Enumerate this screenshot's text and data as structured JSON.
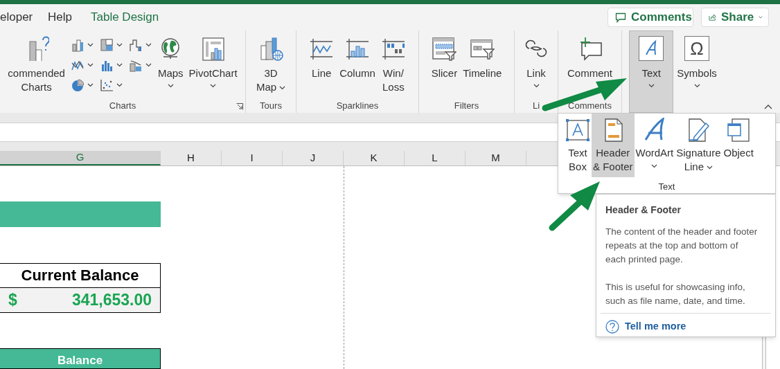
{
  "tabs": [
    {
      "label": "eloper",
      "contextual": false
    },
    {
      "label": "Help",
      "contextual": false
    },
    {
      "label": "Table Design",
      "contextual": true
    }
  ],
  "top_buttons": [
    {
      "kind": "comments",
      "label": "Comments",
      "has_menu": false
    },
    {
      "kind": "share",
      "label": "Share",
      "has_menu": true
    }
  ],
  "ribbon": {
    "groups": [
      {
        "label": "Charts",
        "launcher": true,
        "items": [
          {
            "kind": "large",
            "label": "commended\nCharts",
            "has_menu": false,
            "expanded": false
          },
          {
            "kind": "gallery"
          },
          {
            "kind": "large",
            "label": "Maps",
            "has_menu": true,
            "expanded": false
          },
          {
            "kind": "large",
            "label": "PivotChart",
            "has_menu": true,
            "expanded": false
          }
        ]
      },
      {
        "label": "Tours",
        "launcher": false,
        "items": [
          {
            "kind": "large",
            "label": "3D\nMap",
            "has_menu": true,
            "expanded": false
          }
        ]
      },
      {
        "label": "Sparklines",
        "launcher": false,
        "items": [
          {
            "kind": "large",
            "label": "Line",
            "has_menu": false,
            "expanded": false
          },
          {
            "kind": "large",
            "label": "Column",
            "has_menu": false,
            "expanded": false
          },
          {
            "kind": "large",
            "label": "Win/\nLoss",
            "has_menu": false,
            "expanded": false
          }
        ]
      },
      {
        "label": "Filters",
        "launcher": false,
        "items": [
          {
            "kind": "large",
            "label": "Slicer",
            "has_menu": false,
            "expanded": false
          },
          {
            "kind": "large",
            "label": "Timeline",
            "has_menu": false,
            "expanded": false
          }
        ]
      },
      {
        "label": "Li",
        "launcher": false,
        "items": [
          {
            "kind": "large",
            "label": "Link",
            "has_menu": true,
            "expanded": false
          }
        ]
      },
      {
        "label": "Comments",
        "launcher": false,
        "items": [
          {
            "kind": "large",
            "label": "Comment",
            "has_menu": false,
            "expanded": false
          }
        ]
      },
      {
        "launcher": false,
        "items": [
          {
            "kind": "large",
            "label": "Text",
            "has_menu": true,
            "expanded": true
          },
          {
            "kind": "large",
            "label": "Symbols",
            "has_menu": true,
            "expanded": false,
            "icon_glyph": "Ω"
          }
        ]
      }
    ]
  },
  "columns": [
    {
      "label": "G",
      "selected": true
    },
    {
      "label": "H",
      "selected": false
    },
    {
      "label": "I",
      "selected": false
    },
    {
      "label": "J",
      "selected": false
    },
    {
      "label": "K",
      "selected": false
    },
    {
      "label": "L",
      "selected": false
    },
    {
      "label": "M",
      "selected": false
    }
  ],
  "sheet": {
    "current_balance_header": "Current Balance",
    "currency_symbol": "$",
    "current_balance_value": "341,653.00",
    "balance_header": "Balance"
  },
  "text_menu": {
    "group_label": "Text",
    "items": [
      {
        "label": "Text\nBox",
        "has_menu": false,
        "selected": false
      },
      {
        "label": "Header\n& Footer",
        "has_menu": false,
        "selected": true
      },
      {
        "label": "WordArt",
        "has_menu": true,
        "selected": false
      },
      {
        "label": "Signature\nLine",
        "has_menu": true,
        "selected": false
      },
      {
        "label": "Object",
        "has_menu": false,
        "selected": false
      }
    ]
  },
  "tooltip": {
    "title": "Header & Footer",
    "paragraphs": [
      "The content of the header and footer repeats at the top and bottom of each printed page.",
      "This is useful for showcasing info, such as file name, date, and time."
    ],
    "link": "Tell me more"
  }
}
